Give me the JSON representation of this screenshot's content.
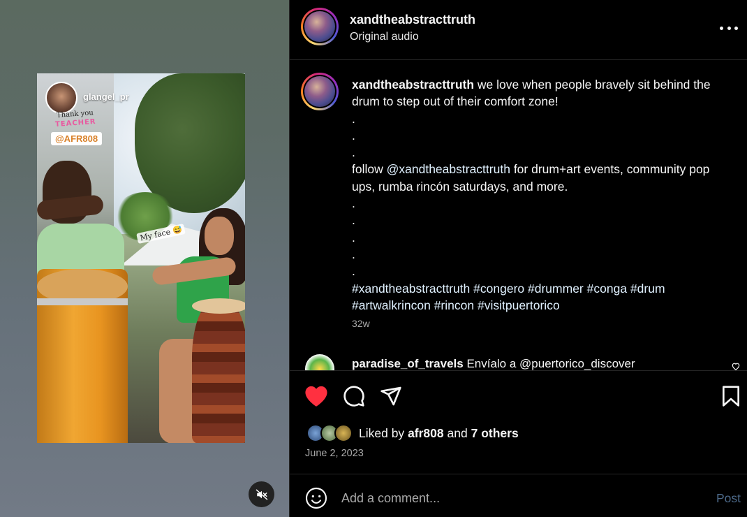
{
  "media": {
    "story_username": "glangel_pr",
    "sticker_line1": "Thank you",
    "sticker_line2": "TEACHER",
    "sticker_mention": "@AFR808",
    "scene_caption": "My face 😅",
    "mute_icon": "speaker-muted-icon"
  },
  "header": {
    "username": "xandtheabstracttruth",
    "audio": "Original audio",
    "more_icon": "more-horizontal-icon"
  },
  "caption": {
    "username": "xandtheabstracttruth",
    "text1": "we love when people bravely sit behind the drum to step out of their comfort zone!",
    "dots_a": [
      ".",
      ".",
      "."
    ],
    "follow_prefix": "follow",
    "follow_mention": "@xandtheabstracttruth",
    "follow_suffix": "for drum+art events, community pop ups, rumba rincón saturdays, and more.",
    "dots_b": [
      ".",
      ".",
      ".",
      ".",
      "."
    ],
    "hashtags": [
      "#xandtheabstracttruth",
      "#congero",
      "#drummer",
      "#conga",
      "#drum",
      "#artwalkrincon",
      "#rincon",
      "#visitpuertorico"
    ],
    "time": "32w"
  },
  "comments": [
    {
      "username": "paradise_of_travels",
      "text": "Envíalo a @puertorico_discover"
    }
  ],
  "actions": {
    "liked_prefix": "Liked by",
    "liked_user": "afr808",
    "liked_and": "and",
    "liked_others": "7 others",
    "date": "June 2, 2023",
    "like_color": "#ff3040"
  },
  "comment_box": {
    "placeholder": "Add a comment...",
    "post_label": "Post"
  }
}
